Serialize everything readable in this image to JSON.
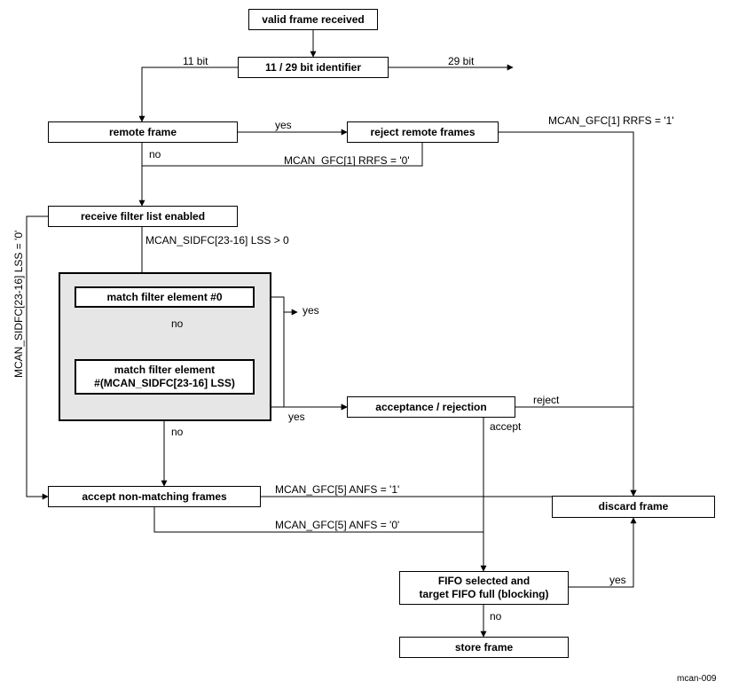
{
  "nodes": {
    "valid_frame": "valid frame received",
    "identifier": "11 / 29 bit identifier",
    "remote_frame": "remote frame",
    "reject_remote": "reject remote frames",
    "filter_list_enabled": "receive filter list enabled",
    "match_filter_0": "match filter element #0",
    "match_filter_n": "match filter element\n#(MCAN_SIDFC[23-16] LSS)",
    "acceptance_rejection": "acceptance / rejection",
    "accept_non_matching": "accept non-matching frames",
    "discard_frame": "discard frame",
    "fifo_block": "FIFO selected and\ntarget FIFO full (blocking)",
    "store_frame": "store frame"
  },
  "labels": {
    "eleven_bit": "11 bit",
    "twentynine_bit": "29 bit",
    "yes": "yes",
    "no": "no",
    "accept": "accept",
    "reject": "reject",
    "rrfs1": "MCAN_GFC[1] RRFS = '1'",
    "rrfs0": "MCAN_GFC[1] RRFS = '0'",
    "lss_gt0": "MCAN_SIDFC[23-16] LSS > 0",
    "lss_eq0": "MCAN_SIDFC[23-16] LSS = '0'",
    "anfs1": "MCAN_GFC[5] ANFS = '1'",
    "anfs0": "MCAN_GFC[5] ANFS = '0'"
  },
  "figure_id": "mcan-009"
}
